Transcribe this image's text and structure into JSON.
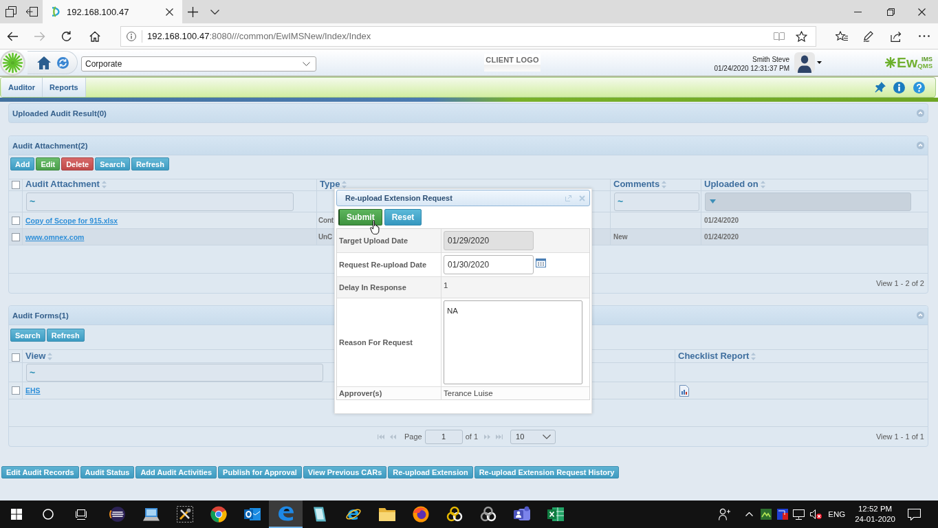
{
  "browser": {
    "tabs": [
      {
        "title": "192.168.100.47",
        "selected": true
      }
    ],
    "nav": {
      "back_enabled": true,
      "forward_enabled": false
    },
    "address": {
      "url": "192.168.100.47:8080///common/EwIMSNew/Index/Index"
    }
  },
  "header": {
    "location": "Corporate",
    "client_logo": "CLIENT LOGO",
    "user": {
      "name": "Smith Steve",
      "datetime": "01/24/2020 12:31:37 PM"
    },
    "brand": {
      "main": "Ew",
      "upper": "IMS",
      "lower": "QMS"
    }
  },
  "menu": {
    "tabs": [
      {
        "label": "Auditor"
      },
      {
        "label": "Reports"
      }
    ]
  },
  "panels": [
    {
      "kind": "summary",
      "title": "Uploaded Audit Result(0)"
    },
    {
      "kind": "attachments",
      "title": "Audit Attachment(2)",
      "buttons": [
        {
          "label": "Add",
          "kind": "info"
        },
        {
          "label": "Edit",
          "kind": "success"
        },
        {
          "label": "Delete",
          "kind": "danger"
        },
        {
          "label": "Search",
          "kind": "info"
        },
        {
          "label": "Refresh",
          "kind": "info"
        }
      ],
      "grid": {
        "all_checked": false,
        "columns": [
          {
            "label": "Audit Attachment",
            "kind": "search",
            "filter": "~"
          },
          {
            "label": "Type",
            "kind": "plain"
          },
          {
            "label": "Comments",
            "kind": "search",
            "filter": "~"
          },
          {
            "label": "Uploaded on",
            "kind": "dropdown"
          }
        ],
        "rows": [
          {
            "checked": false,
            "attachment": "Copy of Scope for 915.xlsx",
            "type": "Cont",
            "uploaded_on": "01/24/2020"
          },
          {
            "checked": false,
            "attachment": "www.omnex.com",
            "type": "UnC",
            "comments": "New",
            "uploaded_on": "01/24/2020"
          }
        ],
        "pager": {
          "summary": "View 1 - 2 of 2"
        }
      }
    },
    {
      "kind": "forms",
      "title": "Audit Forms(1)",
      "buttons": [
        {
          "label": "Search",
          "kind": "info"
        },
        {
          "label": "Refresh",
          "kind": "info"
        }
      ],
      "grid": {
        "all_checked": false,
        "columns": [
          {
            "label": "View",
            "kind": "search",
            "filter": "~"
          },
          {
            "label": "Checklist Report",
            "kind": "plain"
          }
        ],
        "rows": [
          {
            "checked": false,
            "view": "EHS",
            "report": true
          }
        ],
        "pager": {
          "page_label": "Page",
          "page": "1",
          "page_count": "of 1",
          "page_size": "10",
          "summary": "View 1 - 1 of 1"
        }
      }
    }
  ],
  "actions": [
    "Edit Audit Records",
    "Audit Status",
    "Add Audit Activities",
    "Publish for Approval",
    "View Previous CARs",
    "Re-upload Extension",
    "Re-upload Extension Request History"
  ],
  "dialog": {
    "title": "Re-upload Extension Request",
    "buttons": [
      {
        "label": "Submit",
        "kind": "primary"
      },
      {
        "label": "Reset",
        "kind": "secondary"
      }
    ],
    "fields": [
      {
        "label": "Target Upload Date",
        "kind": "date",
        "value": "01/29/2020",
        "disabled": true
      },
      {
        "label": "Request Re-upload Date",
        "kind": "date",
        "value": "01/30/2020",
        "disabled": false
      },
      {
        "label": "Delay In Response",
        "kind": "number",
        "value": "1"
      },
      {
        "label": "Reason For Request",
        "kind": "textarea",
        "value": "NA"
      },
      {
        "label": "Approver(s)",
        "kind": "text",
        "value": "Terance Luise"
      }
    ]
  },
  "taskbar": {
    "apps": [
      {
        "kind": "ring",
        "active": false
      },
      {
        "kind": "laptop",
        "active": false
      },
      {
        "kind": "tools",
        "active": false
      },
      {
        "kind": "wheel",
        "active": false
      },
      {
        "kind": "mail",
        "active": false
      },
      {
        "kind": "swirl",
        "active": true
      },
      {
        "kind": "tablet",
        "active": false
      },
      {
        "kind": "orbit",
        "active": false
      },
      {
        "kind": "folder",
        "active": false
      },
      {
        "kind": "flame",
        "active": false
      },
      {
        "kind": "knot",
        "active": false
      },
      {
        "kind": "rings",
        "active": false
      },
      {
        "kind": "team",
        "active": false
      },
      {
        "kind": "sheet",
        "active": false
      }
    ],
    "tray": {
      "language": "ENG",
      "time": "12:52 PM",
      "date": "24-01-2020"
    }
  }
}
